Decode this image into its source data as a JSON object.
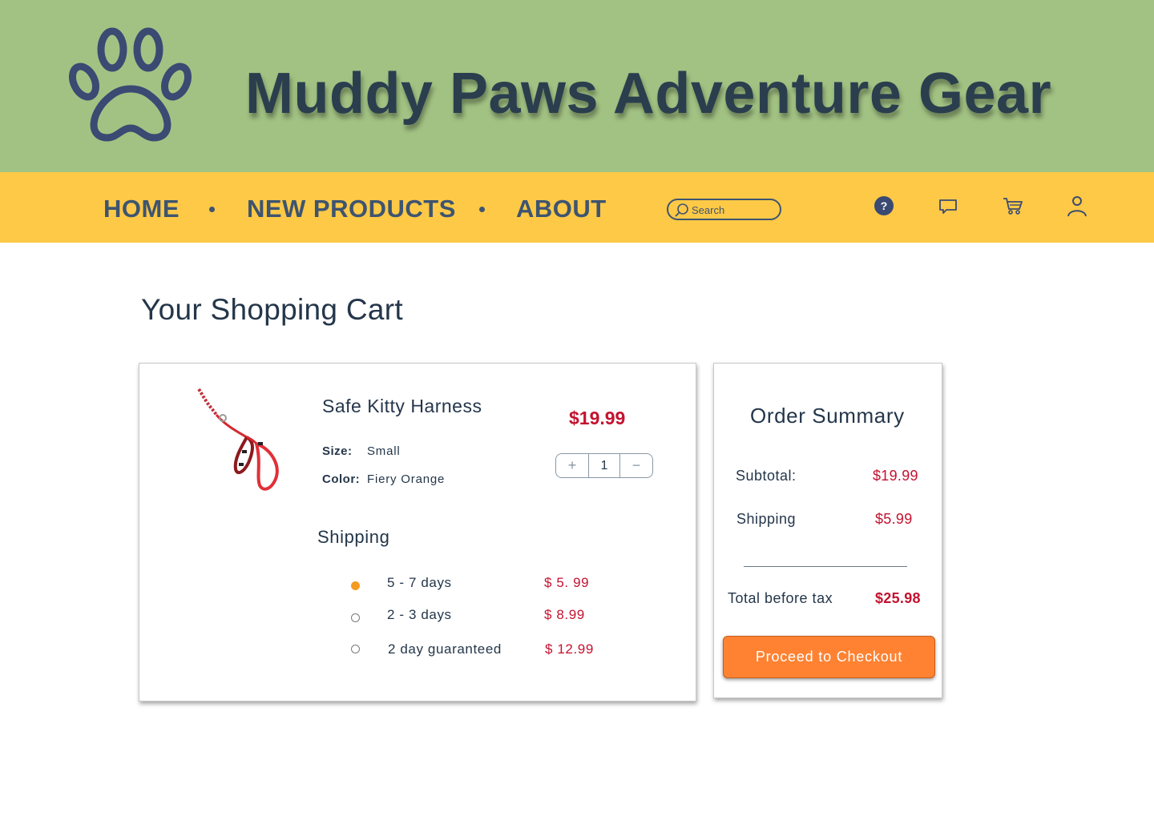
{
  "header": {
    "site_title": "Muddy Paws Adventure Gear",
    "logo_icon": "paw-icon",
    "background_color": "#a2c283"
  },
  "nav": {
    "background_color": "#fec946",
    "links": [
      {
        "label": "HOME"
      },
      {
        "label": "NEW PRODUCTS"
      },
      {
        "label": "ABOUT"
      }
    ],
    "search": {
      "placeholder": "Search",
      "value": ""
    },
    "icons": [
      "help-icon",
      "chat-icon",
      "cart-icon",
      "user-icon"
    ]
  },
  "main": {
    "page_title": "Your Shopping Cart"
  },
  "cart": {
    "item": {
      "name": "Safe Kitty Harness",
      "price": "$19.99",
      "size_label": "Size:",
      "size_value": "Small",
      "color_label": "Color:",
      "color_value": "Fiery Orange",
      "quantity": "1",
      "increment_symbol": "+",
      "decrement_symbol": "−"
    },
    "shipping": {
      "heading": "Shipping",
      "options": [
        {
          "label": "5 - 7 days",
          "price": "$ 5. 99",
          "selected": true
        },
        {
          "label": "2 - 3 days",
          "price": "$ 8.99",
          "selected": false
        },
        {
          "label": "2 day guaranteed",
          "price": "$ 12.99",
          "selected": false
        }
      ]
    }
  },
  "summary": {
    "title": "Order Summary",
    "subtotal_label": "Subtotal:",
    "subtotal_value": "$19.99",
    "shipping_label": "Shipping",
    "shipping_value": "$5.99",
    "total_label": "Total before tax",
    "total_value": "$25.98",
    "checkout_label": "Proceed to Checkout"
  },
  "colors": {
    "accent_price": "#c4122f",
    "checkout_button": "#fe8232",
    "selected_radio": "#f39a22",
    "text_dark": "#24364a"
  }
}
